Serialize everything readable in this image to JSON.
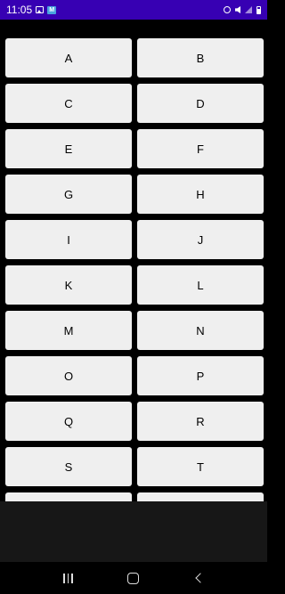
{
  "status_bar": {
    "time": "11:05",
    "color": "#3700b3"
  },
  "keys": [
    "A",
    "B",
    "C",
    "D",
    "E",
    "F",
    "G",
    "H",
    "I",
    "J",
    "K",
    "L",
    "M",
    "N",
    "O",
    "P",
    "Q",
    "R",
    "S",
    "T",
    "",
    ""
  ],
  "colors": {
    "background": "#000000",
    "button": "#efefef",
    "lower_area": "#171717"
  },
  "nav_icons": [
    "recents-icon",
    "home-icon",
    "back-icon"
  ]
}
